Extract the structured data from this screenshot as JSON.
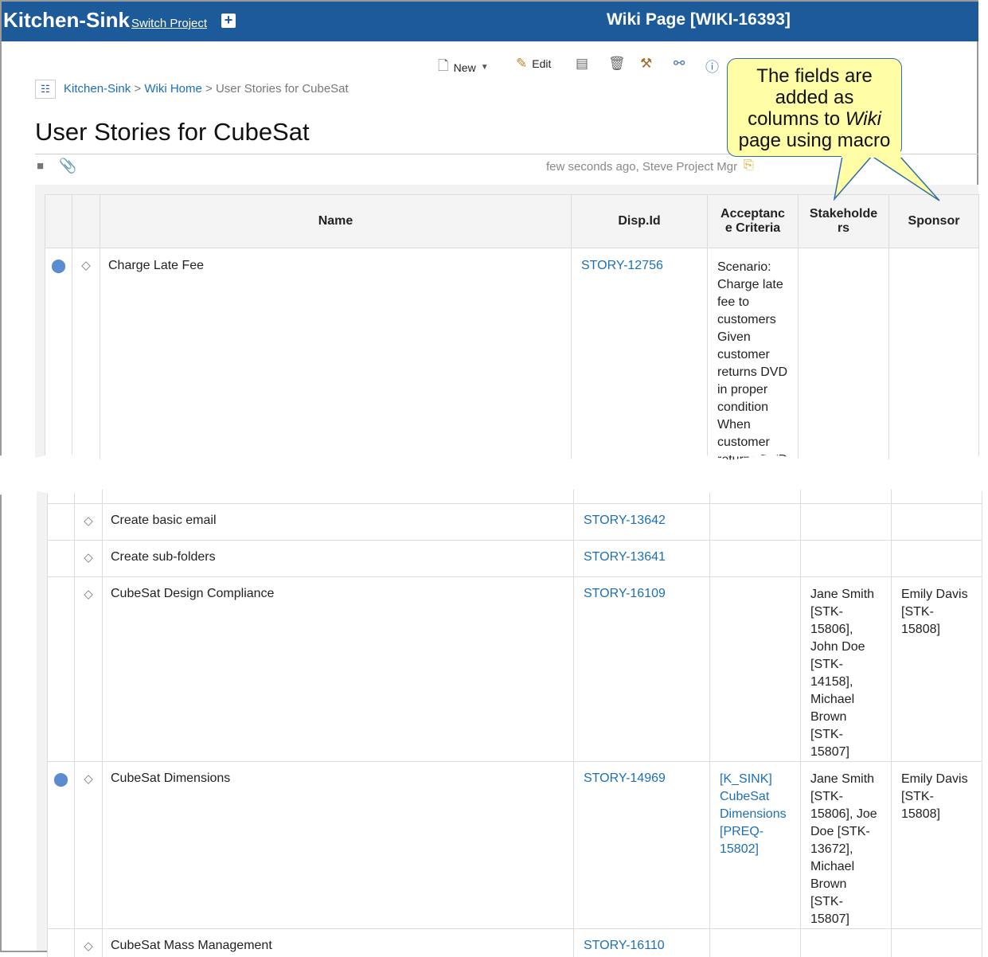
{
  "header": {
    "app_title": "Kitchen-Sink",
    "switch_project": "Switch Project",
    "plus": "+",
    "page_heading": "Wiki Page [WIKI-16393]"
  },
  "toolbar": {
    "new_label": "New",
    "edit_label": "Edit"
  },
  "breadcrumb": {
    "items": [
      "Kitchen-Sink",
      "Wiki Home",
      "User Stories for CubeSat"
    ],
    "separator": ">"
  },
  "page": {
    "title": "User Stories for CubeSat",
    "meta": "few seconds ago, Steve Project Mgr"
  },
  "callout": {
    "line1": "The fields are",
    "line2": "added as",
    "line3_a": "columns to ",
    "line3_b": "Wiki",
    "line4": "page using macro"
  },
  "table": {
    "headers": {
      "name": "Name",
      "disp_id": "Disp.Id",
      "acceptance_1": "Acceptanc",
      "acceptance_2": "e Criteria",
      "stakeholders_1": "Stakeholde",
      "stakeholders_2": "rs",
      "sponsor": "Sponsor"
    },
    "first_row": {
      "name": "Charge Late Fee",
      "id": "STORY-12756",
      "acceptance": [
        "Scenario:",
        "Charge late",
        "fee to",
        "customers",
        "Given",
        "customer",
        "returns DVD",
        "in proper",
        "condition",
        "When",
        "customer",
        "returns DVD"
      ]
    },
    "rows": [
      {
        "name": "Create basic email",
        "id": "STORY-13642"
      },
      {
        "name": "Create sub-folders",
        "id": "STORY-13641"
      },
      {
        "name": "CubeSat Design Compliance",
        "id": "STORY-16109",
        "stakeholders": [
          "Jane Smith",
          "[STK-",
          "15806],",
          "John Doe",
          "[STK-",
          "14158],",
          "Michael",
          "Brown",
          "[STK-15807]"
        ],
        "sponsor": [
          "Emily Davis",
          "[STK-15808]"
        ]
      },
      {
        "name": "CubeSat Dimensions",
        "id": "STORY-14969",
        "acceptance": [
          "[K_SINK]",
          "CubeSat",
          "Dimensions",
          "[PREQ-",
          "15802]"
        ],
        "stakeholders": [
          "Jane Smith",
          "[STK-",
          "15806], Joe",
          "Doe [STK-",
          "13672],",
          "Michael",
          "Brown",
          "[STK-15807]"
        ],
        "sponsor": [
          "Emily Davis",
          "[STK-15808]"
        ]
      },
      {
        "name": "CubeSat Mass Management",
        "id": "STORY-16110"
      }
    ]
  }
}
